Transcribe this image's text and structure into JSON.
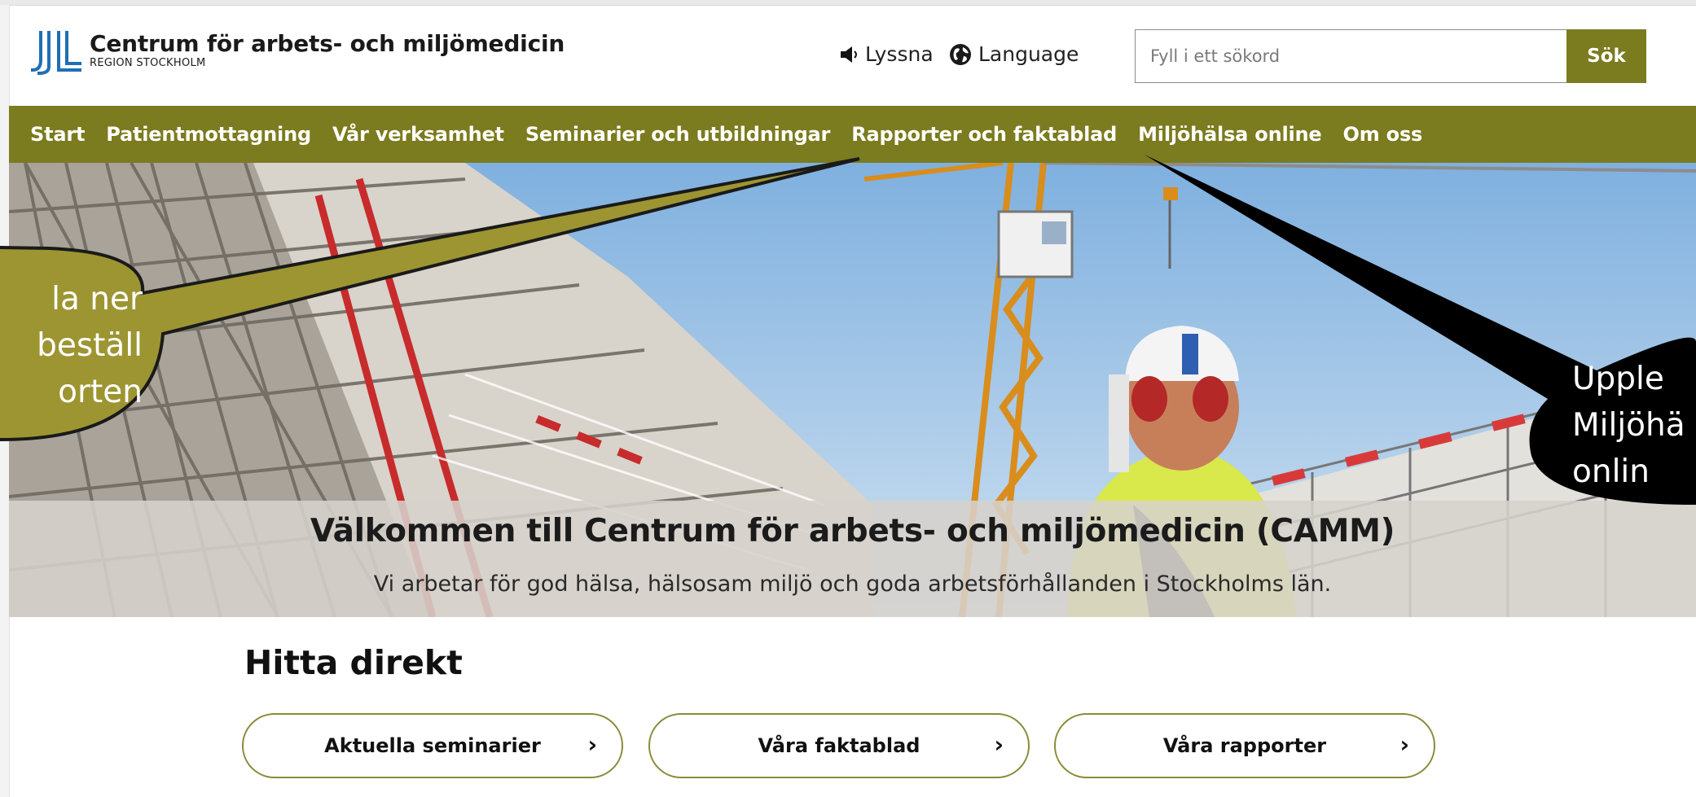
{
  "header": {
    "logo_title": "Centrum för arbets- och miljömedicin",
    "logo_sub": "REGION STOCKHOLM",
    "listen_label": "Lyssna",
    "language_label": "Language",
    "listen_icon": "speaker-icon",
    "language_icon": "globe-icon"
  },
  "search": {
    "placeholder": "Fyll i ett sökord",
    "value": "",
    "button_label": "Sök"
  },
  "nav": {
    "items": [
      {
        "label": "Start"
      },
      {
        "label": "Patientmottagning"
      },
      {
        "label": "Vår verksamhet"
      },
      {
        "label": "Seminarier och utbildningar"
      },
      {
        "label": "Rapporter och faktablad"
      },
      {
        "label": "Miljöhälsa online"
      },
      {
        "label": "Om oss"
      }
    ]
  },
  "hero": {
    "title": "Välkommen till Centrum för arbets- och miljömedicin (CAMM)",
    "subtitle": "Vi arbetar för god hälsa, hälsosam miljö och goda arbetsförhållanden i Stockholms län."
  },
  "quick": {
    "heading": "Hitta direkt",
    "links": [
      {
        "label": "Aktuella seminarier"
      },
      {
        "label": "Våra faktablad"
      },
      {
        "label": "Våra rapporter"
      }
    ]
  },
  "callouts": {
    "left": {
      "lines": [
        "la ner",
        "beställ",
        "orten"
      ]
    },
    "right": {
      "lines": [
        "Upple",
        "Miljöhä",
        "onlin"
      ]
    }
  },
  "colors": {
    "brand_olive": "#7b7b1f",
    "callout_olive": "#9c9532",
    "logo_blue": "#1f6fb5"
  }
}
